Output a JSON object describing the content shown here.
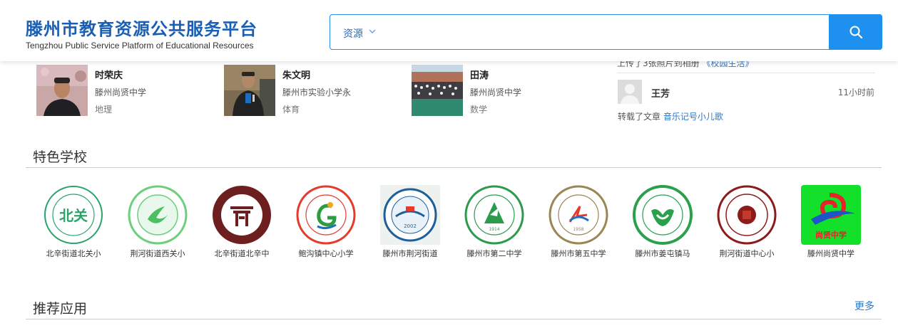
{
  "header": {
    "title": "滕州市教育资源公共服务平台",
    "subtitle": "Tengzhou Public Service Platform of Educational Resources",
    "search_type": "资源",
    "search_placeholder": "",
    "search_icon": "search-icon",
    "accent_color": "#1e90ef"
  },
  "teachers": [
    {
      "name": "时荣庆",
      "school": "滕州尚贤中学",
      "subject": "地理"
    },
    {
      "name": "朱文明",
      "school": "滕州市实验小学永",
      "subject": "体育"
    },
    {
      "name": "田涛",
      "school": "滕州尚贤中学",
      "subject": "数学"
    }
  ],
  "activity": {
    "prev_text": "上传了3张照片到相册",
    "prev_link": "《校园生活》",
    "user": "王芳",
    "time": "11小时前",
    "action": "转载了文章",
    "article": "音乐记号小儿歌"
  },
  "featured_schools": {
    "title": "特色学校",
    "items": [
      {
        "name": "北辛街道北关小",
        "logo_text": "北关"
      },
      {
        "name": "荆河街道西关小",
        "logo_text": ""
      },
      {
        "name": "北辛街道北辛中",
        "logo_text": ""
      },
      {
        "name": "鲍沟镇中心小学",
        "logo_text": ""
      },
      {
        "name": "滕州市荆河街道",
        "logo_text": "2002"
      },
      {
        "name": "滕州市第二中学",
        "logo_text": "1914"
      },
      {
        "name": "滕州市第五中学",
        "logo_text": "1958"
      },
      {
        "name": "滕州市姜屯镇马",
        "logo_text": ""
      },
      {
        "name": "荆河街道中心小",
        "logo_text": ""
      },
      {
        "name": "滕州尚贤中学",
        "logo_text": "尚贤中学"
      }
    ]
  },
  "recommended_apps": {
    "title": "推荐应用",
    "more": "更多"
  }
}
